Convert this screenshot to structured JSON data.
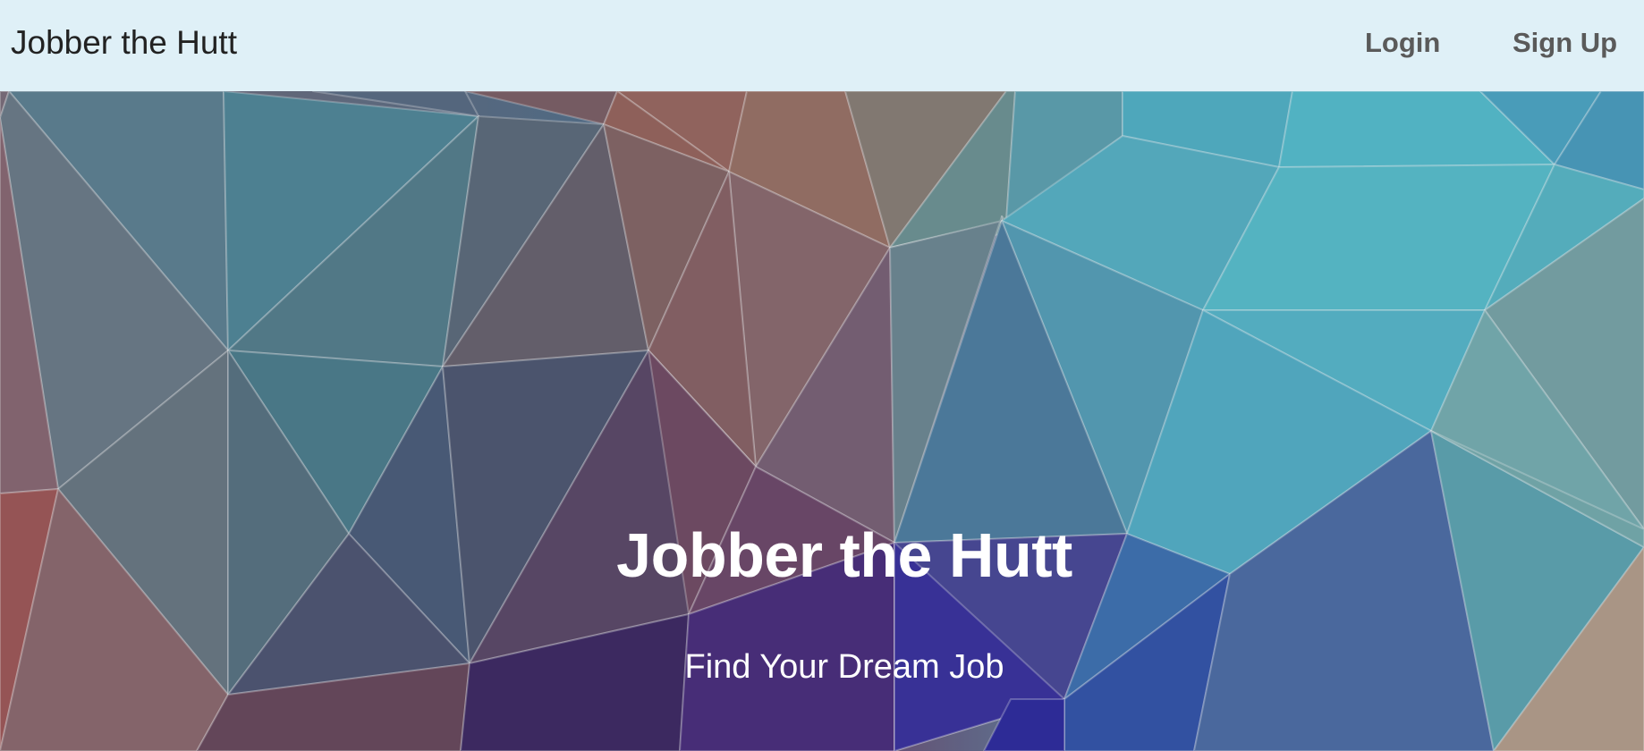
{
  "navbar": {
    "brand": "Jobber the Hutt",
    "links": [
      {
        "label": "Login"
      },
      {
        "label": "Sign Up"
      }
    ]
  },
  "hero": {
    "title": "Jobber the Hutt",
    "subtitle": "Find Your Dream Job",
    "background_description_colors": [
      "#5b8896",
      "#4f7ea3",
      "#5a4a6e",
      "#9a6f64",
      "#5bc1d0",
      "#3c63ad",
      "#3f2b74",
      "#a05a5a"
    ]
  }
}
